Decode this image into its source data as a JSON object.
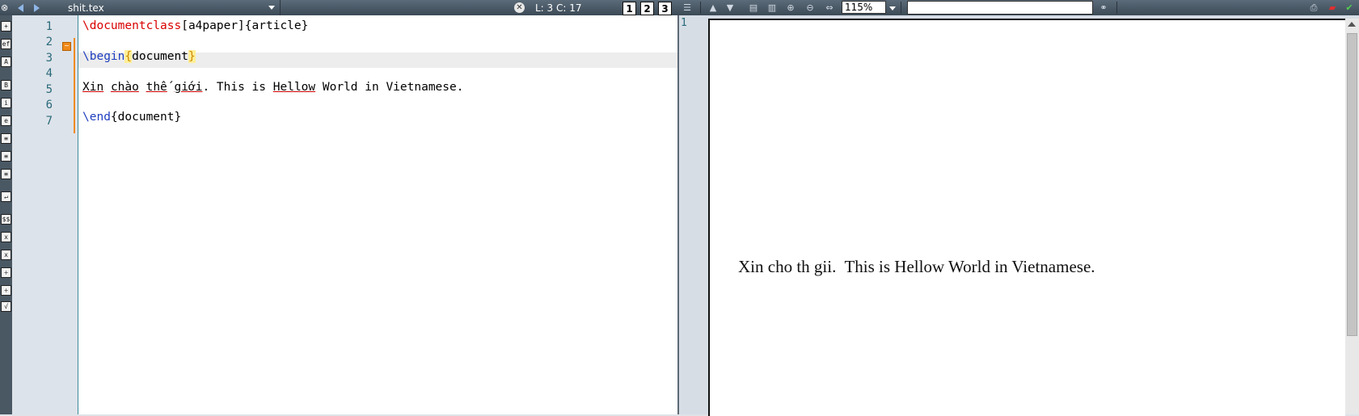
{
  "toolbar": {
    "filename": "shit.tex",
    "cursor_position": "L: 3 C: 17",
    "view_buttons": [
      "1",
      "2",
      "3"
    ],
    "zoom": "115%",
    "search_value": ""
  },
  "editor": {
    "line_numbers": [
      "1",
      "2",
      "3",
      "4",
      "5",
      "6",
      "7"
    ],
    "lines": {
      "l1_cmd": "\\documentclass",
      "l1_opt": "[a4paper]",
      "l1_arg": "{article}",
      "l3_cmd": "\\begin",
      "l3_open": "{",
      "l3_arg": "document",
      "l3_close": "}",
      "l5_w1": "Xin",
      "l5_w2": "chào",
      "l5_w3": "thế",
      "l5_w4": "giới",
      "l5_w5": ". This is ",
      "l5_w6": "Hellow",
      "l5_w7": " World in Vietnamese.",
      "l7_cmd": "\\end",
      "l7_arg": "{document}"
    },
    "current_line": 3
  },
  "pdf": {
    "page_number": "1",
    "rendered_text": "Xin cho th gii.  This is Hellow World in Vietnamese."
  },
  "colors": {
    "keyword": "#1f3fbf",
    "fold_marker": "#f08a1a",
    "spellcheck": "#d00000"
  }
}
